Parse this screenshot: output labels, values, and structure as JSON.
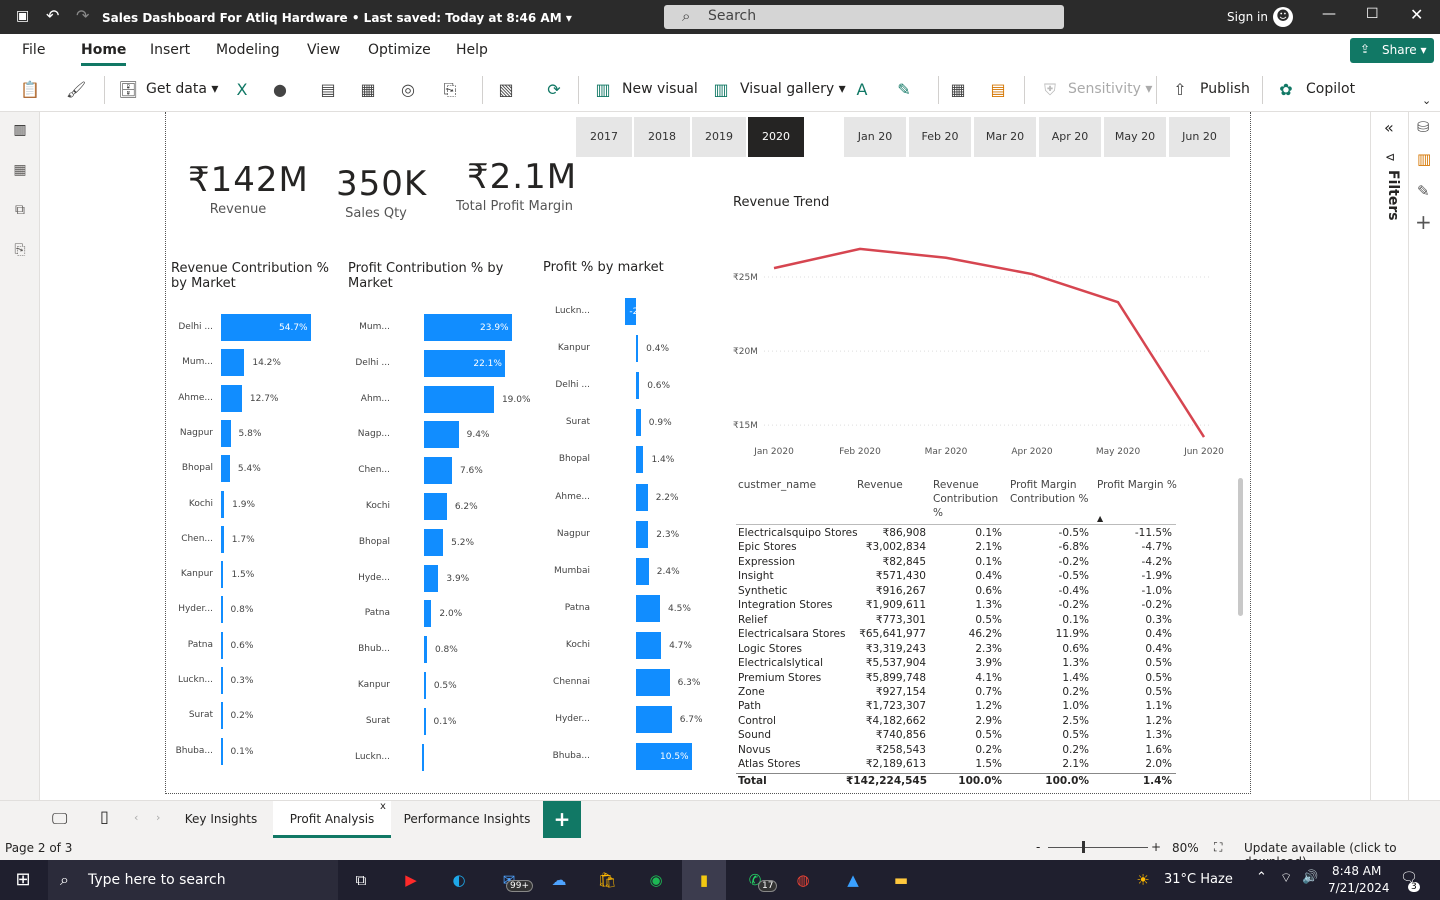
{
  "window": {
    "title": "Sales Dashboard For Atliq Hardware",
    "saved": "Last saved: Today at 8:46 AM",
    "search_placeholder": "Search",
    "signin": "Sign in"
  },
  "ribbon": {
    "tabs": [
      "File",
      "Home",
      "Insert",
      "Modeling",
      "View",
      "Optimize",
      "Help"
    ],
    "share": "Share",
    "tools": {
      "get_data": "Get data",
      "new_visual": "New visual",
      "visual_gallery": "Visual gallery",
      "sensitivity": "Sensitivity",
      "publish": "Publish",
      "copilot": "Copilot"
    }
  },
  "filters_label": "Filters",
  "slicers": {
    "years": [
      "2017",
      "2018",
      "2019",
      "2020"
    ],
    "selected_year": "2020",
    "months": [
      "Jan 20",
      "Feb 20",
      "Mar 20",
      "Apr 20",
      "May 20",
      "Jun 20"
    ]
  },
  "kpis": [
    {
      "value": "₹142M",
      "label": "Revenue"
    },
    {
      "value": "350K",
      "label": "Sales Qty"
    },
    {
      "value": "₹2.1M",
      "label": "Total Profit Margin"
    }
  ],
  "chart_data": [
    {
      "type": "bar",
      "title": "Revenue Contribution % by Market",
      "categories": [
        "Delhi ...",
        "Mum...",
        "Ahme...",
        "Nagpur",
        "Bhopal",
        "Kochi",
        "Chen...",
        "Kanpur",
        "Hyder...",
        "Patna",
        "Luckn...",
        "Surat",
        "Bhuba..."
      ],
      "values": [
        54.7,
        14.2,
        12.7,
        5.8,
        5.4,
        1.9,
        1.7,
        1.5,
        0.8,
        0.6,
        0.3,
        0.2,
        0.1
      ],
      "labels": [
        "54.7%",
        "14.2%",
        "12.7%",
        "5.8%",
        "5.4%",
        "1.9%",
        "1.7%",
        "1.5%",
        "0.8%",
        "0.6%",
        "0.3%",
        "0.2%",
        "0.1%"
      ]
    },
    {
      "type": "bar",
      "title": "Profit Contribution % by Market",
      "categories": [
        "Mum...",
        "Delhi ...",
        "Ahm...",
        "Nagp...",
        "Chen...",
        "Kochi",
        "Bhopal",
        "Hyde...",
        "Patna",
        "Bhub...",
        "Kanpur",
        "Surat",
        "Luckn..."
      ],
      "values": [
        23.9,
        22.1,
        19.0,
        9.4,
        7.6,
        6.2,
        5.2,
        3.9,
        2.0,
        0.8,
        0.5,
        0.1,
        -0.5
      ],
      "labels": [
        "23.9%",
        "22.1%",
        "19.0%",
        "9.4%",
        "7.6%",
        "6.2%",
        "5.2%",
        "3.9%",
        "2.0%",
        "0.8%",
        "0.5%",
        "0.1%",
        ""
      ]
    },
    {
      "type": "bar",
      "title": "Profit % by market",
      "categories": [
        "Luckn...",
        "Kanpur",
        "Delhi ...",
        "Surat",
        "Bhopal",
        "Ahme...",
        "Nagpur",
        "Mumbai",
        "Patna",
        "Kochi",
        "Chennai",
        "Hyder...",
        "Bhuba..."
      ],
      "values": [
        -2.0,
        0.4,
        0.6,
        0.9,
        1.4,
        2.2,
        2.3,
        2.4,
        4.5,
        4.7,
        6.3,
        6.7,
        10.5
      ],
      "labels": [
        "-2",
        "0.4%",
        "0.6%",
        "0.9%",
        "1.4%",
        "2.2%",
        "2.3%",
        "2.4%",
        "4.5%",
        "4.7%",
        "6.3%",
        "6.7%",
        "10.5%"
      ]
    },
    {
      "type": "line",
      "title": "Revenue Trend",
      "x": [
        "Jan 2020",
        "Feb 2020",
        "Mar 2020",
        "Apr 2020",
        "May 2020",
        "Jun 2020"
      ],
      "values": [
        25.6,
        26.9,
        26.3,
        25.2,
        23.3,
        14.2
      ],
      "y_ticks": [
        "₹25M",
        "₹20M",
        "₹15M"
      ],
      "y_tick_values": [
        25,
        20,
        15
      ],
      "ylim": [
        14,
        27.5
      ],
      "color": "#d64550"
    }
  ],
  "table": {
    "columns": [
      "custmer_name",
      "Revenue",
      "Revenue Contribution %",
      "Profit Margin Contribution %",
      "Profit Margin %"
    ],
    "rows": [
      [
        "Electricalsquipo Stores",
        "₹86,908",
        "0.1%",
        "-0.5%",
        "-11.5%"
      ],
      [
        "Epic Stores",
        "₹3,002,834",
        "2.1%",
        "-6.8%",
        "-4.7%"
      ],
      [
        "Expression",
        "₹82,845",
        "0.1%",
        "-0.2%",
        "-4.2%"
      ],
      [
        "Insight",
        "₹571,430",
        "0.4%",
        "-0.5%",
        "-1.9%"
      ],
      [
        "Synthetic",
        "₹916,267",
        "0.6%",
        "-0.4%",
        "-1.0%"
      ],
      [
        "Integration Stores",
        "₹1,909,611",
        "1.3%",
        "-0.2%",
        "-0.2%"
      ],
      [
        "Relief",
        "₹773,301",
        "0.5%",
        "0.1%",
        "0.3%"
      ],
      [
        "Electricalsara Stores",
        "₹65,641,977",
        "46.2%",
        "11.9%",
        "0.4%"
      ],
      [
        "Logic Stores",
        "₹3,319,243",
        "2.3%",
        "0.6%",
        "0.4%"
      ],
      [
        "Electricalslytical",
        "₹5,537,904",
        "3.9%",
        "1.3%",
        "0.5%"
      ],
      [
        "Premium Stores",
        "₹5,899,748",
        "4.1%",
        "1.4%",
        "0.5%"
      ],
      [
        "Zone",
        "₹927,154",
        "0.7%",
        "0.2%",
        "0.5%"
      ],
      [
        "Path",
        "₹1,723,307",
        "1.2%",
        "1.0%",
        "1.1%"
      ],
      [
        "Control",
        "₹4,182,662",
        "2.9%",
        "2.5%",
        "1.2%"
      ],
      [
        "Sound",
        "₹740,856",
        "0.5%",
        "0.5%",
        "1.3%"
      ],
      [
        "Novus",
        "₹258,543",
        "0.2%",
        "0.2%",
        "1.6%"
      ],
      [
        "Atlas Stores",
        "₹2,189,613",
        "1.5%",
        "2.1%",
        "2.0%"
      ]
    ],
    "total": [
      "Total",
      "₹142,224,545",
      "100.0%",
      "100.0%",
      "1.4%"
    ]
  },
  "page_tabs": [
    "Key Insights",
    "Profit Analysis",
    "Performance Insights"
  ],
  "active_tab": "Profit Analysis",
  "status": {
    "page": "Page 2 of 3",
    "zoom": "80%",
    "update": "Update available (click to download)"
  },
  "taskbar": {
    "search": "Type here to search",
    "weather": "31°C  Haze",
    "time": "8:48 AM",
    "date": "7/21/2024",
    "mail_badge": "99+",
    "whatsapp_badge": "17",
    "notif_badge": "3"
  }
}
